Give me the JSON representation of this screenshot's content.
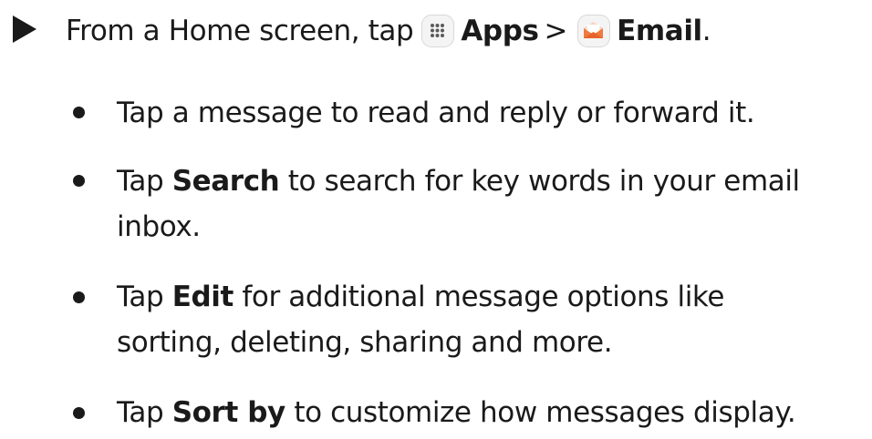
{
  "step": {
    "prefix": "From a Home screen, tap",
    "apps_icon": "apps-grid-icon",
    "apps_label": "Apps",
    "separator": ">",
    "email_icon": "email-envelope-icon",
    "email_label": "Email",
    "suffix": "."
  },
  "bullets": [
    {
      "pre": "Tap a message to read and reply or forward it.",
      "bold": "",
      "post": "",
      "cont": ""
    },
    {
      "pre": "Tap ",
      "bold": "Search",
      "post": " to search for key words in your email",
      "cont": "inbox."
    },
    {
      "pre": "Tap ",
      "bold": "Edit",
      "post": " for additional message options like",
      "cont": "sorting, deleting, sharing and more."
    },
    {
      "pre": "Tap ",
      "bold": "Sort by",
      "post": " to customize how messages display.",
      "cont": ""
    }
  ],
  "colors": {
    "text": "#1a1a1a",
    "email_icon_orange": "#f07a3f",
    "email_icon_light": "#fbd3bd"
  }
}
